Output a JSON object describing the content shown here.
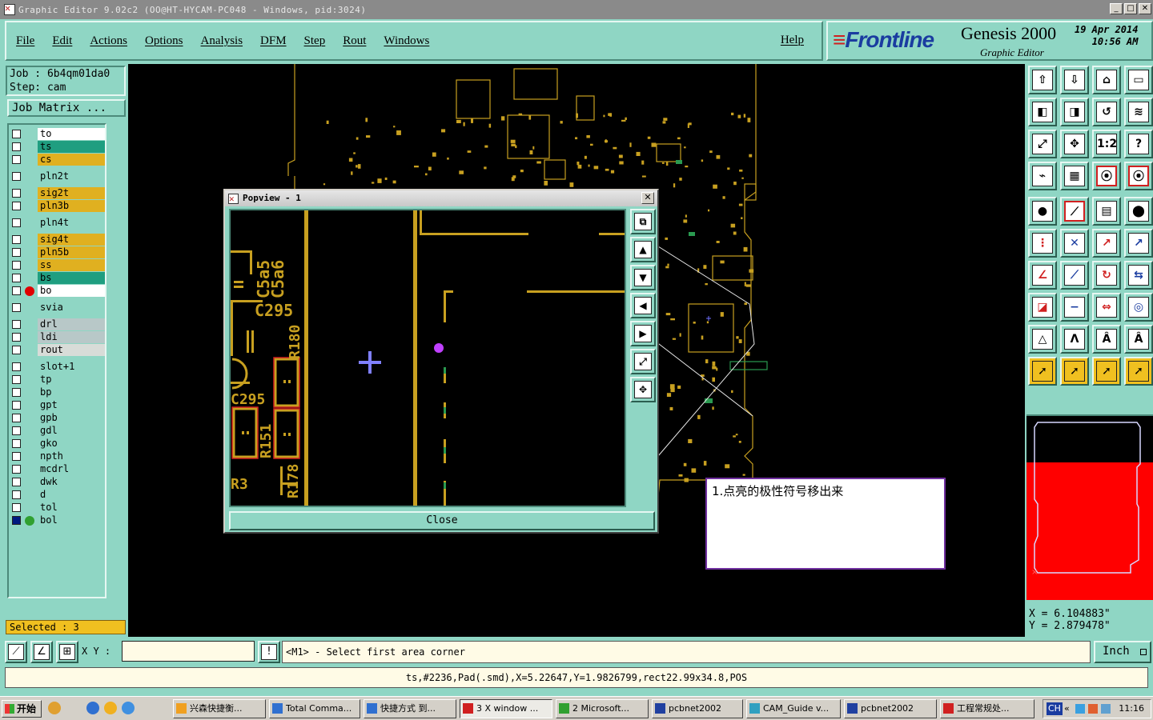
{
  "window": {
    "title": "Graphic Editor 9.02c2 (OO@HT-HYCAM-PC048 - Windows, pid:3024)"
  },
  "menu": [
    "File",
    "Edit",
    "Actions",
    "Options",
    "Analysis",
    "DFM",
    "Step",
    "Rout",
    "Windows"
  ],
  "help_label": "Help",
  "brand": {
    "logo": "Frontline",
    "product": "Genesis 2000",
    "subtitle": "Graphic Editor",
    "date": "19 Apr 2014",
    "time": "10:56 AM"
  },
  "job": {
    "job_line": "Job : 6b4qm01da0",
    "step_line": "Step: cam",
    "matrix_label": "Job Matrix ..."
  },
  "layers": [
    {
      "name": "to",
      "color": "#ffffff",
      "arrow": true
    },
    {
      "name": "ts",
      "color": "#1f9e80",
      "arrow": true
    },
    {
      "name": "cs",
      "color": "#e0b020",
      "arrow": true
    },
    {
      "name": "pln2t",
      "color": "#8fd6c4",
      "arrow": false
    },
    {
      "name": "sig2t",
      "color": "#e0b020",
      "arrow": true
    },
    {
      "name": "pln3b",
      "color": "#e0b020",
      "arrow": false
    },
    {
      "name": "pln4t",
      "color": "#8fd6c4",
      "arrow": false
    },
    {
      "name": "sig4t",
      "color": "#e0b020",
      "arrow": true
    },
    {
      "name": "pln5b",
      "color": "#e0b020",
      "arrow": false
    },
    {
      "name": "ss",
      "color": "#e0b020",
      "arrow": true
    },
    {
      "name": "bs",
      "color": "#1f9e80",
      "arrow": true
    },
    {
      "name": "bo",
      "color": "#ffffff",
      "arrow": true,
      "marker": "#e00000"
    },
    {
      "name": "svia",
      "color": "#8fd6c4",
      "arrow": false
    },
    {
      "name": "drl",
      "color": "#b8c8c8",
      "arrow": false
    },
    {
      "name": "ldi",
      "color": "#b8c8c8",
      "arrow": false
    },
    {
      "name": "rout",
      "color": "#d8dcd8",
      "arrow": false
    },
    {
      "name": "slot+1",
      "color": "#8fd6c4",
      "arrow": false
    },
    {
      "name": "tp",
      "color": "#8fd6c4",
      "arrow": false
    },
    {
      "name": "bp",
      "color": "#8fd6c4",
      "arrow": false
    },
    {
      "name": "gpt",
      "color": "#8fd6c4",
      "arrow": false
    },
    {
      "name": "gpb",
      "color": "#8fd6c4",
      "arrow": false
    },
    {
      "name": "gdl",
      "color": "#8fd6c4",
      "arrow": true
    },
    {
      "name": "gko",
      "color": "#8fd6c4",
      "arrow": true
    },
    {
      "name": "npth",
      "color": "#8fd6c4",
      "arrow": false
    },
    {
      "name": "mcdrl",
      "color": "#8fd6c4",
      "arrow": false
    },
    {
      "name": "dwk",
      "color": "#8fd6c4",
      "arrow": false
    },
    {
      "name": "d",
      "color": "#8fd6c4",
      "arrow": false
    },
    {
      "name": "tol",
      "color": "#8fd6c4",
      "arrow": true
    },
    {
      "name": "bol",
      "color": "#8fd6c4",
      "arrow": true,
      "marker": "#30a030",
      "checked": true
    }
  ],
  "selected_label": "Selected : 3",
  "popview": {
    "title": "Popview - 1",
    "close_label": "Close"
  },
  "note_text": "1.点亮的极性符号移出来",
  "coords": {
    "x": "X = 6.104883\"",
    "y": "Y = 2.879478\""
  },
  "command": {
    "xy_label": "X Y :",
    "xy_value": "",
    "prompt": "<M1> - Select first area corner",
    "unit": "Inch"
  },
  "status_line": "ts,#2236,Pad(.smd),X=5.22647,Y=1.9826799,rect22.99x34.8,POS",
  "taskbar": {
    "start": "开始",
    "tasks": [
      "兴森快捷衡...",
      "Total Comma...",
      "快捷方式 到...",
      "3 X window ...",
      "2 Microsoft...",
      "pcbnet2002",
      "CAM_Guide v...",
      "pcbnet2002",
      "工程常规处..."
    ],
    "tray_lang": "CH",
    "clock": "11:16"
  },
  "colors": {
    "accent": "#8fd6c4",
    "trace": "#c8a020",
    "highlight": "#e00000"
  }
}
